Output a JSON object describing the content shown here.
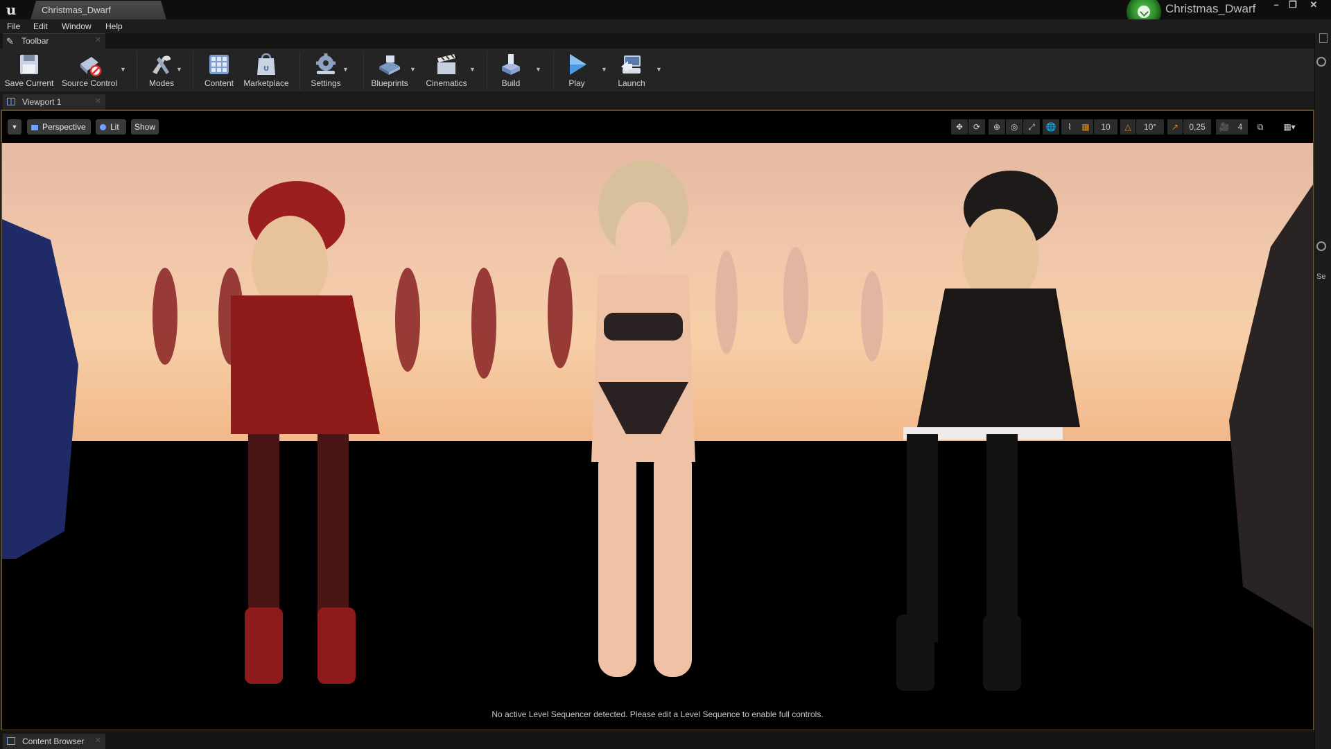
{
  "window": {
    "document_tab": "Christmas_Dwarf",
    "project_name": "Christmas_Dwarf",
    "controls": [
      "–",
      "❐",
      "✕"
    ]
  },
  "menu": [
    "File",
    "Edit",
    "Window",
    "Help"
  ],
  "toolbar_tab": {
    "label": "Toolbar"
  },
  "toolbar": {
    "save": "Save Current",
    "source_control": "Source Control",
    "modes": "Modes",
    "content": "Content",
    "marketplace": "Marketplace",
    "settings": "Settings",
    "blueprints": "Blueprints",
    "cinematics": "Cinematics",
    "build": "Build",
    "play": "Play",
    "launch": "Launch"
  },
  "viewport_tab": {
    "label": "Viewport 1"
  },
  "viewport_toolbar": {
    "perspective": "Perspective",
    "lit": "Lit",
    "show": "Show",
    "grid_snap_value": "10",
    "rotation_snap_value": "10°",
    "scale_snap_value": "0,25",
    "camera_speed": "4"
  },
  "viewport_status": "No active Level Sequencer detected. Please edit a Level Sequence to enable full controls.",
  "right_panel": {
    "label": "Se"
  },
  "bottom_tab": {
    "label": "Content Browser"
  },
  "colors": {
    "accent_blue": "#6ea2ff",
    "play_blue": "#3e8fe0",
    "snap_orange": "#e08a1e",
    "badge_green": "#3fae3a"
  }
}
